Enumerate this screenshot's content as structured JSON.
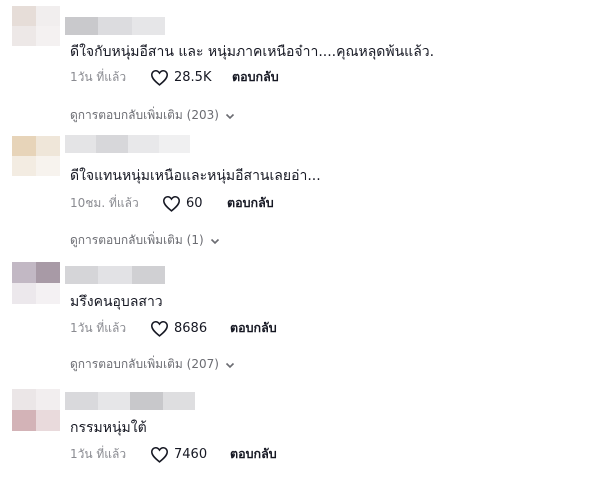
{
  "comments": [
    {
      "text": "ดีใจกับหนุ่มอีสาน และ หนุ่มภาคเหนือจ๋าา....คุณหลุดพ้นแล้ว.",
      "time": "1วัน ที่แล้ว",
      "likes": "28.5K",
      "reply_label": "ตอบกลับ",
      "more_replies": "ดูการตอบกลับเพิ่มเติม (203)"
    },
    {
      "text": "ดีใจแทนหนุ่มเหนือและหนุ่มอีสานเลยอ่า...",
      "time": "10ชม. ที่แล้ว",
      "likes": "60",
      "reply_label": "ตอบกลับ",
      "more_replies": "ดูการตอบกลับเพิ่มเติม (1)"
    },
    {
      "text": "มรึงคนอุบลสาว",
      "time": "1วัน ที่แล้ว",
      "likes": "8686",
      "reply_label": "ตอบกลับ",
      "more_replies": "ดูการตอบกลับเพิ่มเติม (207)"
    },
    {
      "text": "กรรมหนุ่มใต้",
      "time": "1วัน ที่แล้ว",
      "likes": "7460",
      "reply_label": "ตอบกลับ"
    }
  ],
  "icons": {
    "like": "heart-outline-icon",
    "expand": "chevron-down-icon"
  },
  "colors": {
    "text": "#161823",
    "meta": "#8a8b91",
    "more": "#6b6c72"
  }
}
